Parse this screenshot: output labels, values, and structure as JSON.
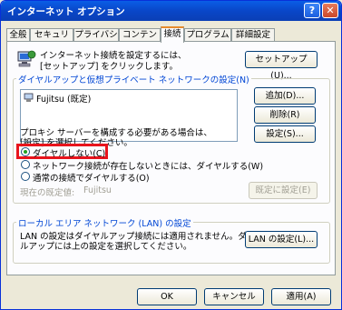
{
  "window": {
    "title": "インターネット オプション"
  },
  "tabs": [
    "全般",
    "セキュリティ",
    "プライバシー",
    "コンテンツ",
    "接続",
    "プログラム",
    "詳細設定"
  ],
  "setup": {
    "text_line1": "インターネット接続を設定するには、",
    "text_line2": "[セットアップ] をクリックします。",
    "button": "セットアップ(U)..."
  },
  "dialup": {
    "group_label": "ダイヤルアップと仮想プライベート ネットワークの設定(N)",
    "connections": [
      {
        "name": "Fujitsu (既定)"
      }
    ],
    "add_button": "追加(D)...",
    "remove_button": "削除(R)",
    "settings_button": "設定(S)...",
    "proxy_text_line1": "プロキシ サーバーを構成する必要がある場合は、",
    "proxy_text_line2": "[設定] を選択してください。",
    "radios": [
      {
        "label": "ダイヤルしない(C)",
        "checked": true
      },
      {
        "label": "ネットワーク接続が存在しないときには、ダイヤルする(W)",
        "checked": false
      },
      {
        "label": "通常の接続でダイヤルする(O)",
        "checked": false
      }
    ],
    "current_default_label": "現在の既定値:",
    "current_default_value": "Fujitsu",
    "set_default_button": "既定に設定(E)"
  },
  "lan": {
    "group_label": "ローカル エリア ネットワーク (LAN) の設定",
    "text_line1": "LAN の設定はダイヤルアップ接続には適用されません。ダイヤ",
    "text_line2": "ルアップには上の設定を選択してください。",
    "button": "LAN の設定(L)..."
  },
  "footer": {
    "ok": "OK",
    "cancel": "キャンセル",
    "apply": "適用(A)"
  },
  "colors": {
    "title_bar": "#0a5ee6",
    "highlight": "#e8141c",
    "group_label": "#0046d5"
  }
}
